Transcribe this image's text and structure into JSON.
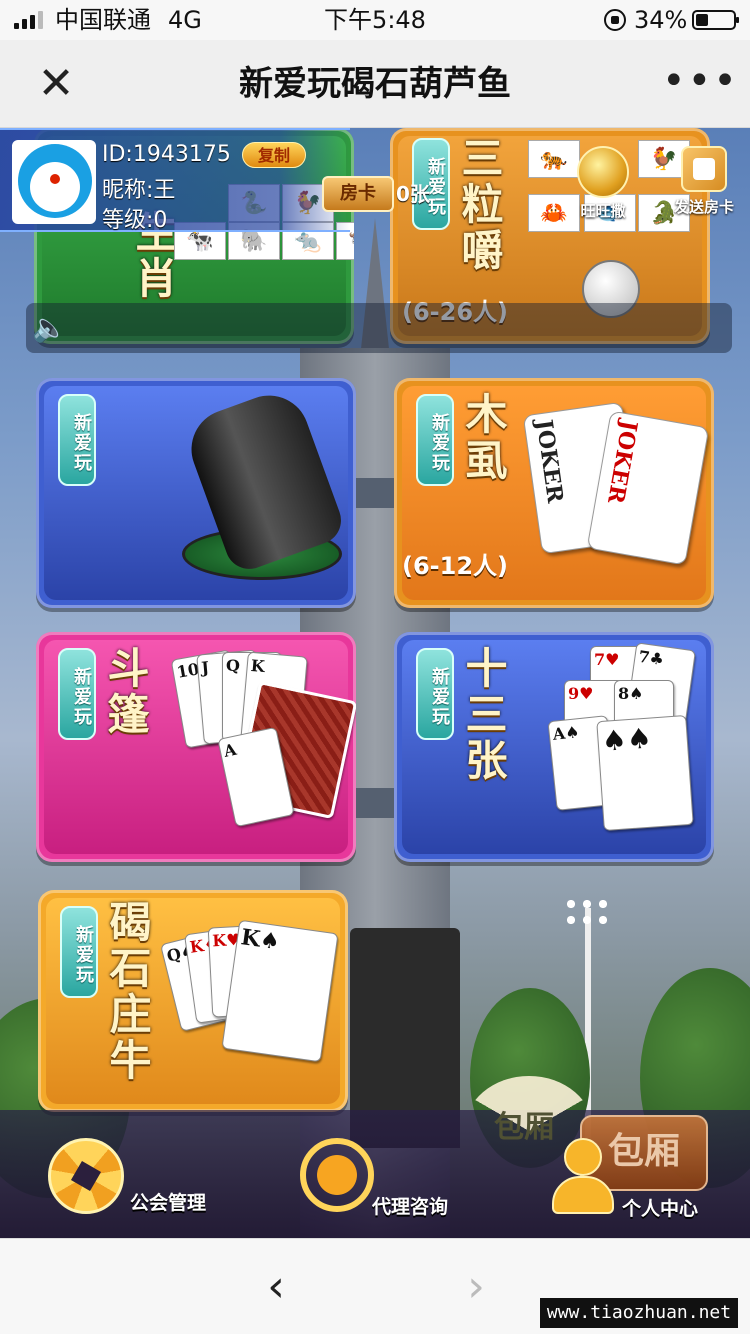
{
  "status_bar": {
    "carrier": "中国联通",
    "network": "4G",
    "time": "下午5:48",
    "battery": "34%",
    "battery_level": 0.34,
    "signal_bars": 3
  },
  "nav": {
    "title": "新爱玩碣石葫芦鱼",
    "close_icon": "close-icon",
    "more_icon": "more-icon",
    "more_glyph": "•••",
    "close_glyph": "✕"
  },
  "profile": {
    "id": "ID:1943175",
    "copy_label": "复制",
    "nickname": "昵称:王",
    "level": "等级:0",
    "room_card_label": "房卡",
    "room_card_count": "0张"
  },
  "top_icons": {
    "recharge": "旺旺撒",
    "send_card": "发送房卡"
  },
  "badge_text": "新爱玩",
  "games": [
    {
      "title": "生肖",
      "players": ""
    },
    {
      "title": "三粒嚼",
      "players": "(6-26人)"
    },
    {
      "title": "",
      "players": ""
    },
    {
      "title": "木虱",
      "players": "(6-12人)"
    },
    {
      "title": "斗篷",
      "players": ""
    },
    {
      "title": "十三张",
      "players": ""
    },
    {
      "title": "碣石庄牛",
      "players": ""
    }
  ],
  "joker_text": "JOKER",
  "bottom_nav": {
    "guild": "公会管理",
    "agent": "代理咨询",
    "profile": "个人中心",
    "box": "包厢",
    "fan_text": "包厢"
  },
  "browser": {
    "back_glyph": "‹",
    "forward_glyph": "›"
  },
  "watermark": "www.tiaozhuan.net",
  "colors": {
    "green_card": "#2f9a3e",
    "orange_card": "#e7921f",
    "blue_card": "#3f5fd0",
    "pink_card": "#e8379b",
    "yellow_card": "#f4a92a"
  }
}
